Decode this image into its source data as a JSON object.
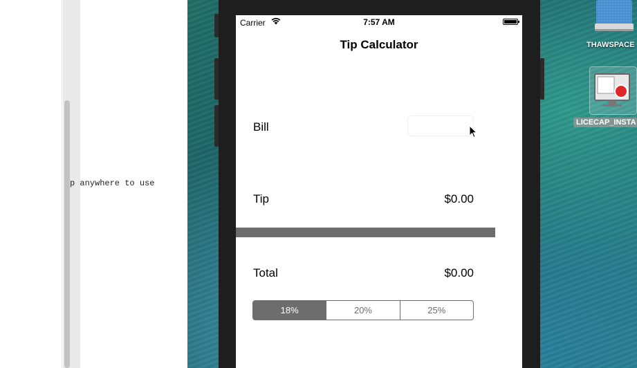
{
  "editor": {
    "code_line": "p anywhere to use"
  },
  "simulator": {
    "status_bar": {
      "carrier": "Carrier",
      "time": "7:57 AM"
    },
    "nav_title": "Tip Calculator",
    "bill": {
      "label": "Bill",
      "value": ""
    },
    "tip": {
      "label": "Tip",
      "value": "$0.00"
    },
    "total": {
      "label": "Total",
      "value": "$0.00"
    },
    "tip_segments": [
      {
        "label": "18%",
        "selected": true
      },
      {
        "label": "20%",
        "selected": false
      },
      {
        "label": "25%",
        "selected": false
      }
    ]
  },
  "desktop_icons": {
    "drive": {
      "label": "THAWSPACE",
      "icon": "hard-drive-icon"
    },
    "licecap": {
      "label": "LICECAP_INSTA",
      "icon": "licecap-icon"
    }
  },
  "colors": {
    "segment_accent": "#6d6d6d",
    "device_bezel": "#1e1e1e",
    "record_red": "#e0262b"
  }
}
